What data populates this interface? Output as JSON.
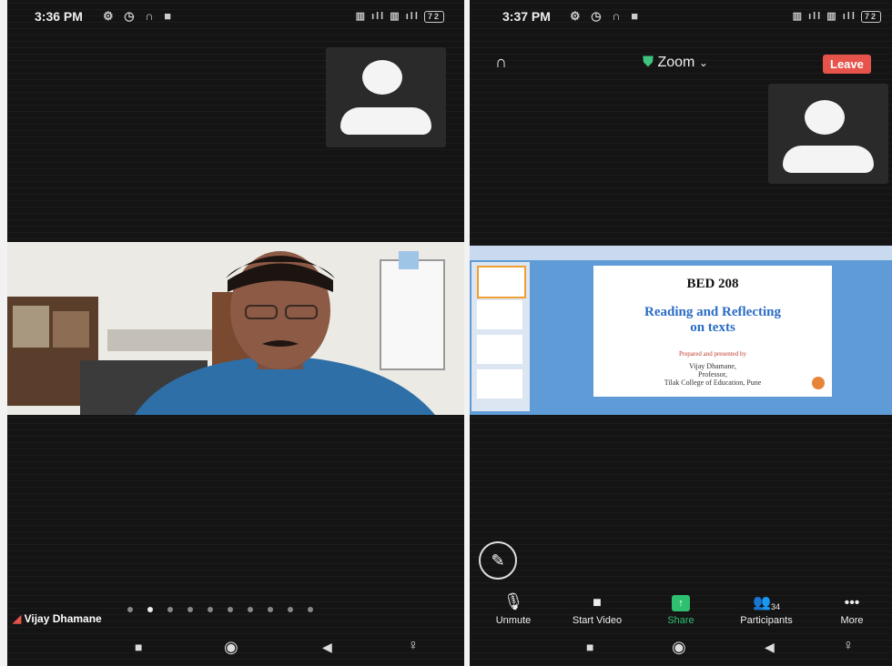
{
  "left_screen": {
    "status": {
      "time": "3:36 PM",
      "battery": "72"
    },
    "participant_name": "Vijay Dhamane",
    "page_dots": {
      "count": 10,
      "active_index": 1
    }
  },
  "right_screen": {
    "status": {
      "time": "3:37 PM",
      "battery": "72"
    },
    "topbar": {
      "app_name": "Zoom",
      "leave_label": "Leave"
    },
    "slide": {
      "code": "BED 208",
      "title_line1": "Reading and Reflecting",
      "title_line2": "on texts",
      "prepared_by": "Prepared and presented by",
      "presenter": "Vijay Dhamane,",
      "role": "Professor,",
      "college": "Tilak College of Education, Pune"
    },
    "toolbar": {
      "unmute": "Unmute",
      "start_video": "Start Video",
      "share": "Share",
      "participants": "Participants",
      "participants_count": "34",
      "more": "More"
    }
  },
  "colors": {
    "leave": "#e5534b",
    "share": "#2fbf71",
    "shield": "#3ec47e",
    "slide_title": "#2b6cc4",
    "slide_red": "#c0392b"
  }
}
